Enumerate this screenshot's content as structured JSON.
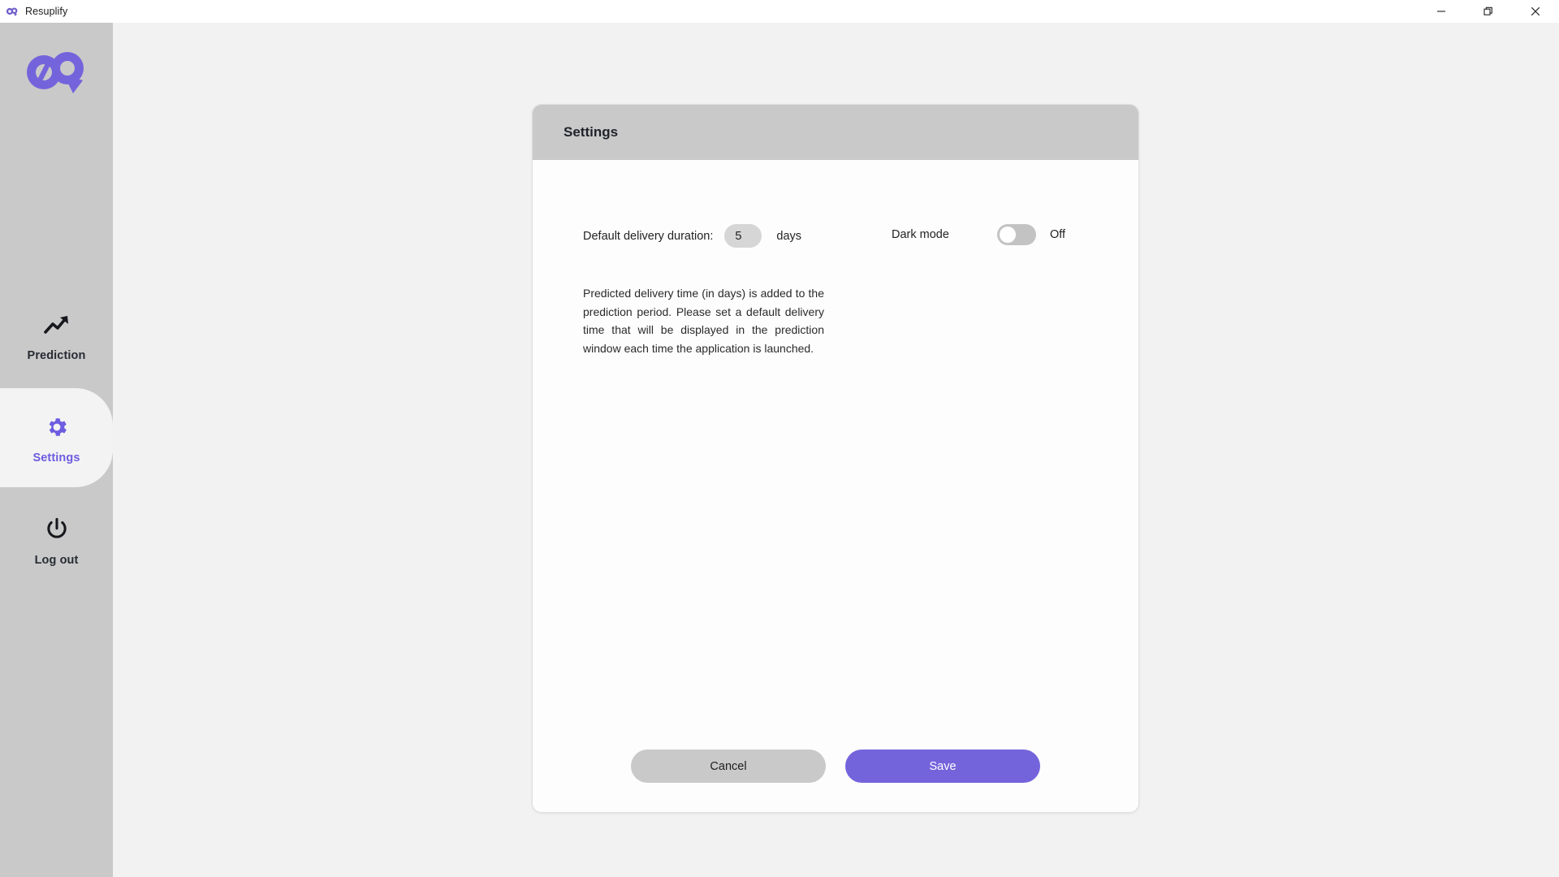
{
  "window": {
    "app_icon": "resuplify-logo-icon",
    "title": "Resuplify",
    "controls": {
      "minimize_label": "Minimize",
      "maximize_label": "Restore",
      "close_label": "Close"
    }
  },
  "sidebar": {
    "logo_icon": "resuplify-brand-logo",
    "items": [
      {
        "id": "prediction",
        "label": "Prediction",
        "icon": "trending-up-icon",
        "active": false
      },
      {
        "id": "settings",
        "label": "Settings",
        "icon": "gear-icon",
        "active": true
      },
      {
        "id": "logout",
        "label": "Log out",
        "icon": "power-icon",
        "active": false
      }
    ]
  },
  "card": {
    "title": "Settings",
    "duration": {
      "label": "Default delivery duration:",
      "value": "5",
      "placeholder": "5",
      "unit": "days"
    },
    "dark_mode": {
      "label": "Dark mode",
      "state": "Off",
      "enabled": false
    },
    "description": "Predicted delivery time (in days) is added to the prediction period. Please set a default delivery time that will be displayed in the prediction window each time the application is launched.",
    "actions": {
      "cancel_label": "Cancel",
      "save_label": "Save"
    }
  },
  "colors": {
    "accent_purple": "#7464dc",
    "sidebar_grey": "#c9c9c9",
    "card_header_grey": "#c9c9c9",
    "page_background": "#f2f2f2",
    "card_background": "#fdfdfd",
    "input_grey": "#d6d6d6",
    "toggle_track_grey": "#c3c3c3"
  }
}
